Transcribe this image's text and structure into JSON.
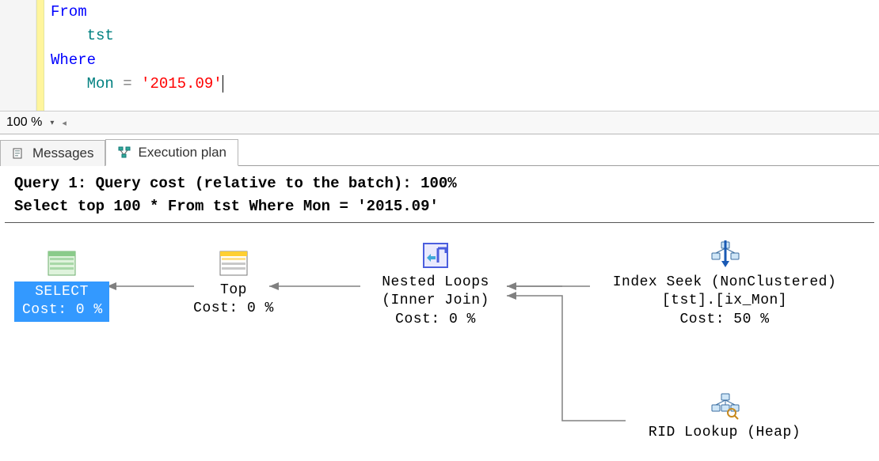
{
  "sql": {
    "line1_kw": "From",
    "line2_ident": "tst",
    "line3_kw": "Where",
    "line4_ident": "Mon",
    "line4_op": " = ",
    "line4_str": "'2015.09'"
  },
  "zoom": {
    "value": "100 %"
  },
  "tabs": {
    "messages": "Messages",
    "execplan": "Execution plan"
  },
  "plan": {
    "header_line1": "Query 1: Query cost (relative to the batch): 100%",
    "header_line2": "Select top 100 * From tst Where Mon = '2015.09'",
    "select": {
      "title": "SELECT",
      "cost": "Cost: 0 %"
    },
    "top": {
      "title": "Top",
      "cost": "Cost: 0 %"
    },
    "nested": {
      "title": "Nested Loops",
      "sub": "(Inner Join)",
      "cost": "Cost: 0 %"
    },
    "seek": {
      "title": "Index Seek (NonClustered)",
      "sub": "[tst].[ix_Mon]",
      "cost": "Cost: 50 %"
    },
    "rid": {
      "title": "RID Lookup (Heap)"
    }
  }
}
